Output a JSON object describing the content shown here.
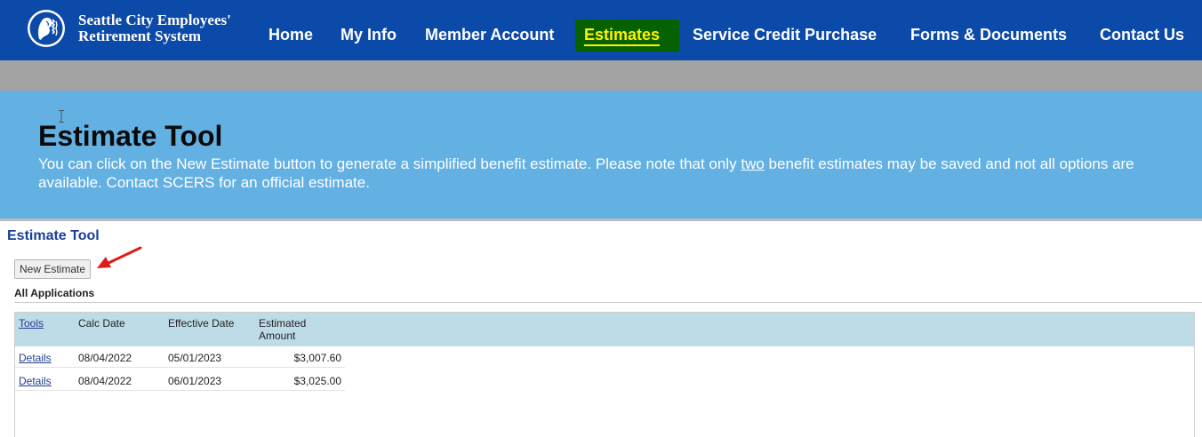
{
  "header": {
    "brand_line1": "Seattle City Employees'",
    "brand_line2": "Retirement System",
    "logo_icon": "seattle-seal-icon",
    "nav": {
      "home": "Home",
      "my_info": "My Info",
      "member_account": "Member Account",
      "estimates": "Estimates",
      "service_credit_purchase": "Service Credit Purchase",
      "forms_documents": "Forms & Documents",
      "contact_us": "Contact Us"
    },
    "active_item": "Estimates"
  },
  "banner": {
    "title": "Estimate Tool",
    "text_before": "You can click on the New Estimate button to generate a simplified benefit estimate. Please note that only ",
    "text_underlined": "two",
    "text_after": " benefit estimates may be saved and not all options are available. Contact SCERS for an official estimate."
  },
  "main": {
    "section_title": "Estimate Tool",
    "new_estimate_button": "New Estimate",
    "applications_label": "All Applications",
    "table": {
      "headers": {
        "tools": "Tools",
        "calc_date": "Calc Date",
        "effective_date": "Effective Date",
        "estimated_amount_line1": "Estimated",
        "estimated_amount_line2": "Amount"
      },
      "rows": [
        {
          "tools": "Details",
          "calc_date": "08/04/2022",
          "effective_date": "05/01/2023",
          "estimated_amount": "$3,007.60"
        },
        {
          "tools": "Details",
          "calc_date": "08/04/2022",
          "effective_date": "06/01/2023",
          "estimated_amount": "$3,025.00"
        }
      ]
    }
  },
  "colors": {
    "nav_bg": "#0b4aa8",
    "nav_active_bg": "#066200",
    "nav_active_text": "#fff200",
    "banner_bg": "#63b0e3",
    "table_header_bg": "#bedbe8",
    "annotation_arrow": "#e01b1b"
  }
}
